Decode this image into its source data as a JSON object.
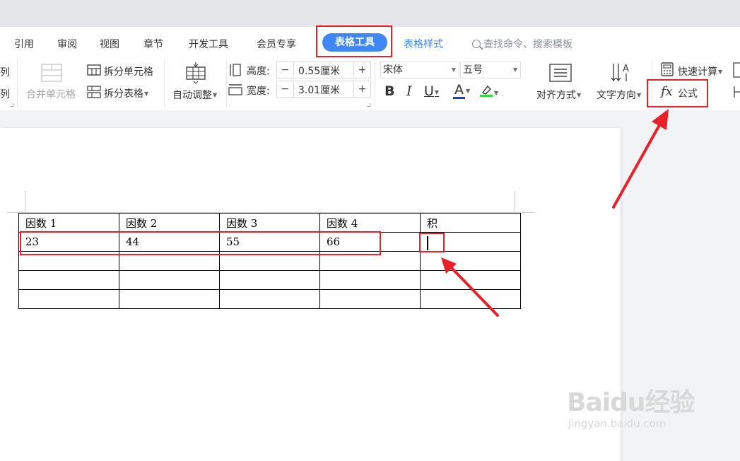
{
  "tabs": {
    "items": [
      {
        "label": "引用"
      },
      {
        "label": "审阅"
      },
      {
        "label": "视图"
      },
      {
        "label": "章节"
      },
      {
        "label": "开发工具"
      },
      {
        "label": "会员专享"
      }
    ],
    "active_label": "表格工具",
    "table_style_label": "表格样式",
    "search_placeholder": "查找命令、搜索模板"
  },
  "ribbon": {
    "left_cut_1": "列",
    "left_cut_2": "列",
    "merge_cells": "合并单元格",
    "split_cells": "拆分单元格",
    "split_table": "拆分表格",
    "auto_fit": "自动调整",
    "height_label": "高度:",
    "height_value": "0.55厘米",
    "width_label": "宽度:",
    "width_value": "3.01厘米",
    "font_name": "宋体",
    "font_size": "五号",
    "bold": "B",
    "italic": "I",
    "underline": "U",
    "font_color": "A",
    "alignment": "对齐方式",
    "text_direction": "文字方向",
    "quick_calc": "快速计算",
    "formula_fx": "fx",
    "formula_label": "公式"
  },
  "document": {
    "header_row": [
      "因数 1",
      "因数 2",
      "因数 3",
      "因数 4",
      "积"
    ],
    "data_row": [
      "23",
      "44",
      "55",
      "66",
      ""
    ],
    "empty_rows": 3
  },
  "watermark": {
    "logo": "Baidu经验",
    "url": "jingyan.baidu.com"
  },
  "colors": {
    "accent": "#3f87f5",
    "annotation_red": "#e8202a",
    "font_color_bar": "#1a3fcc",
    "highlight_bar": "#2fdc3a"
  }
}
